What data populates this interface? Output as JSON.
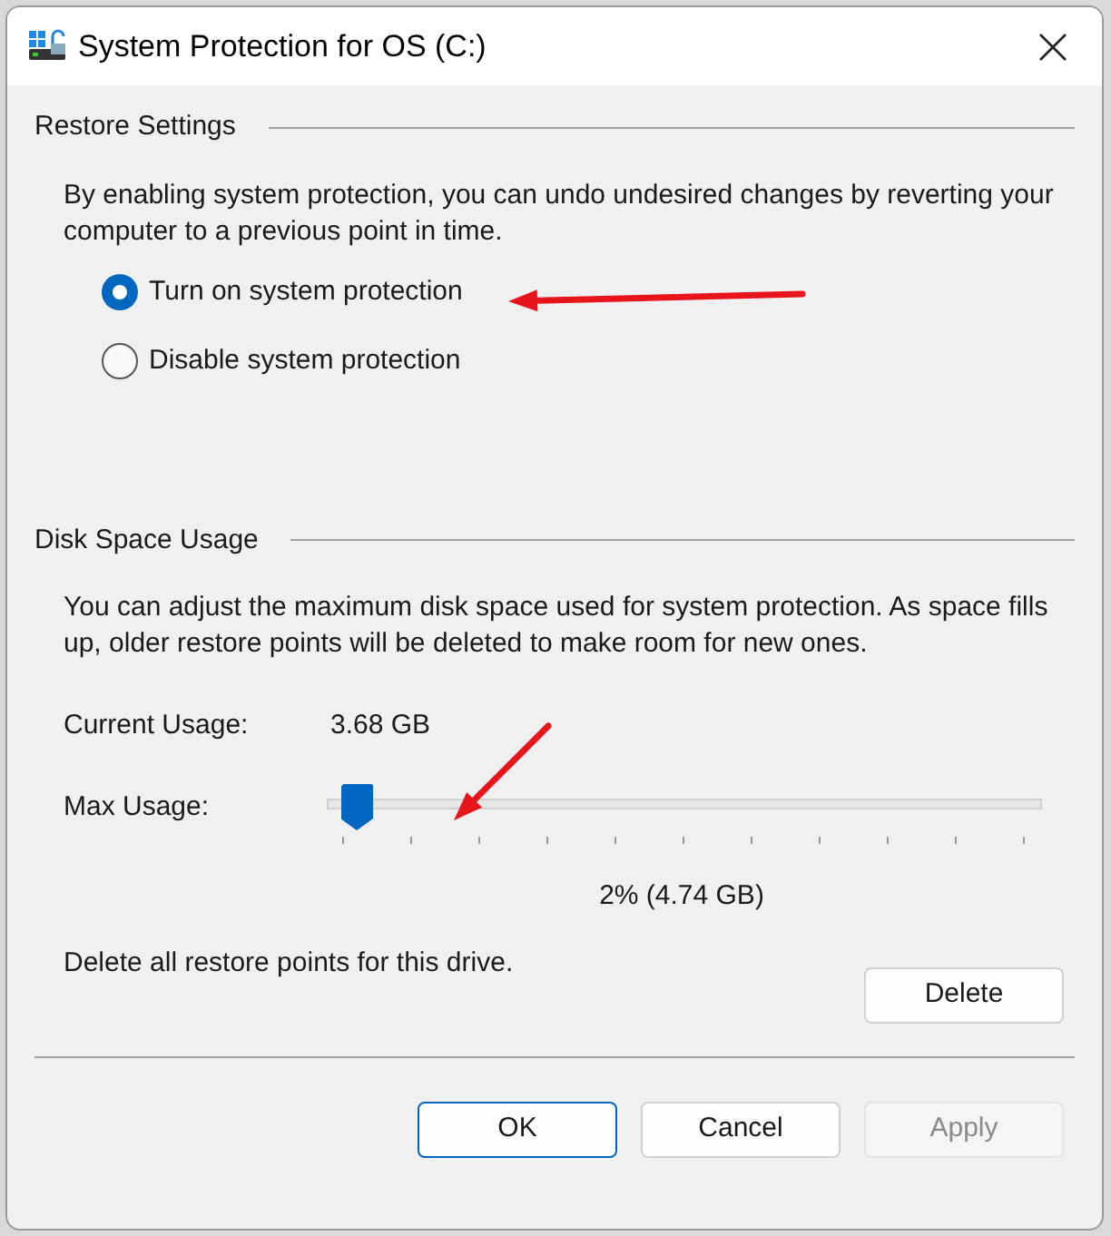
{
  "window": {
    "title": "System Protection for OS (C:)"
  },
  "restore_settings": {
    "heading": "Restore Settings",
    "description": "By enabling system protection, you can undo undesired changes by reverting your computer to a previous point in time.",
    "options": [
      {
        "label": "Turn on system protection",
        "selected": true
      },
      {
        "label": "Disable system protection",
        "selected": false
      }
    ]
  },
  "disk_space_usage": {
    "heading": "Disk Space Usage",
    "description": "You can adjust the maximum disk space used for system protection. As space fills up, older restore points will be deleted to make room for new ones.",
    "current_usage_label": "Current Usage:",
    "current_usage_value": "3.68 GB",
    "max_usage_label": "Max Usage:",
    "max_usage": {
      "level": 0.02,
      "reading": "2% (4.74 GB)"
    },
    "delete_text": "Delete all restore points for this drive.",
    "delete_button": "Delete"
  },
  "buttons": [
    {
      "label": "OK",
      "kind": "default",
      "disabled": false
    },
    {
      "label": "Cancel",
      "kind": "normal",
      "disabled": false
    },
    {
      "label": "Apply",
      "kind": "normal",
      "disabled": true
    }
  ]
}
